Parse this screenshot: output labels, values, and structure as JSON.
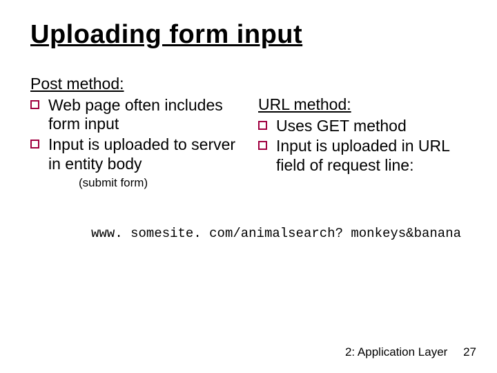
{
  "title": "Uploading form input",
  "left": {
    "heading": "Post method:",
    "items": [
      "Web page often includes form input",
      "Input is uploaded to server in entity body"
    ],
    "note": "(submit form)"
  },
  "right": {
    "heading": "URL method:",
    "items": [
      "Uses GET method",
      "Input is uploaded in URL field of request line:"
    ]
  },
  "url_example": "www. somesite. com/animalsearch? monkeys&banana",
  "footer": {
    "section": "2: Application Layer",
    "page": "27"
  }
}
